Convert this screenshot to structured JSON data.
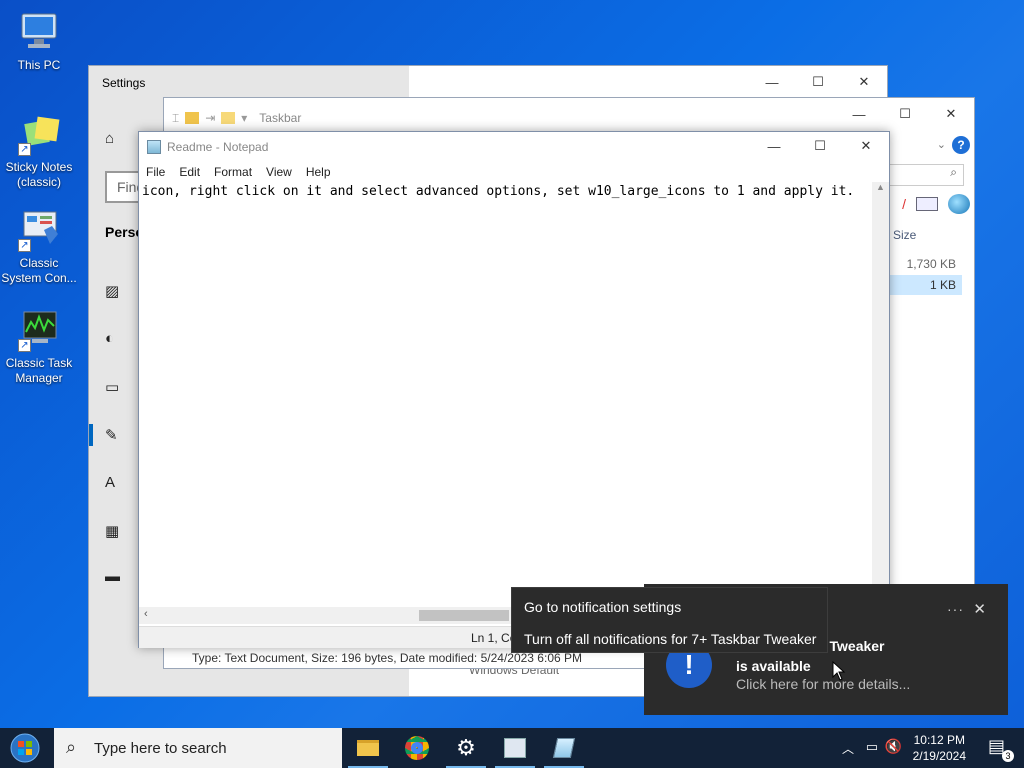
{
  "desktop": {
    "icons": [
      {
        "label": "This PC"
      },
      {
        "label": "Sticky Notes (classic)"
      },
      {
        "label": "Classic System Con..."
      },
      {
        "label": "Classic Task Manager"
      }
    ]
  },
  "settings": {
    "title": "Settings",
    "find_placeholder": "Find",
    "section": "Perso",
    "bottom_text": "Windows Default"
  },
  "explorer": {
    "title": "Taskbar",
    "column_size": "Size",
    "rows": [
      {
        "size": "1,730 KB"
      },
      {
        "size": "1 KB"
      }
    ],
    "status": "Type: Text Document, Size: 196 bytes, Date modified: 5/24/2023 6:06 PM"
  },
  "notepad": {
    "title": "Readme - Notepad",
    "menu": [
      "File",
      "Edit",
      "Format",
      "View",
      "Help"
    ],
    "content": "icon, right click on it and select advanced options, set w10_large_icons to 1 and apply it.",
    "status_pos": "Ln 1, Co"
  },
  "toast": {
    "title_line1": "of 7+ Taskbar Tweaker",
    "title_line2": "is available",
    "body": "Click here for more details...",
    "more_label": "···",
    "close_label": "✕"
  },
  "context_menu": {
    "items": [
      "Go to notification settings",
      "Turn off all notifications for 7+ Taskbar Tweaker"
    ]
  },
  "taskbar": {
    "search_placeholder": "Type here to search",
    "time": "10:12 PM",
    "date": "2/19/2024",
    "notification_count": "3"
  }
}
